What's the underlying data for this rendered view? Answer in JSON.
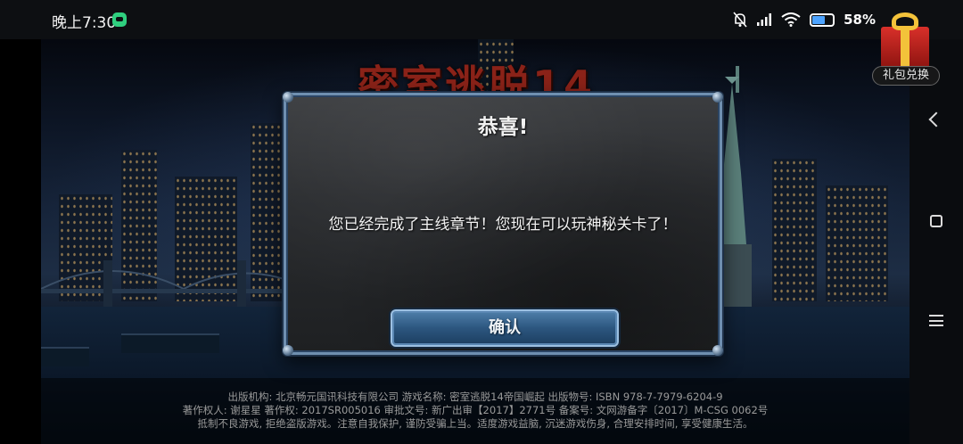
{
  "status_bar": {
    "time": "晚上7:30",
    "battery_percent": "58",
    "battery_level": 0.58,
    "icons": [
      "chat-app-icon",
      "mute-bell-icon",
      "signal-icon",
      "wifi-icon",
      "battery-icon"
    ]
  },
  "game": {
    "logo_text": "密室逃脱14"
  },
  "gift": {
    "label": "礼包兑换"
  },
  "dialog": {
    "title": "恭喜!",
    "message": "您已经完成了主线章节！您现在可以玩神秘关卡了！",
    "confirm_label": "确认"
  },
  "footer": {
    "line1": "出版机构: 北京畅元国讯科技有限公司    游戏名称: 密室逃脱14帝国崛起    出版物号: ISBN 978-7-7979-6204-9",
    "line2": "著作权人: 谢星星    著作权: 2017SR005016    审批文号: 新广出审【2017】2771号    备案号: 文网游备字〔2017〕M-CSG 0062号",
    "line3": "抵制不良游戏, 拒绝盗版游戏。注意自我保护, 谨防受骗上当。适度游戏益脑, 沉迷游戏伤身, 合理安排时间, 享受健康生活。"
  },
  "nav": {
    "icons": [
      "back-icon",
      "home-icon",
      "menu-icon"
    ]
  },
  "colors": {
    "dialog_border": "#6f8fb0",
    "button_blue": "#2c567f",
    "status_bar_bg": "#0d0f12"
  }
}
